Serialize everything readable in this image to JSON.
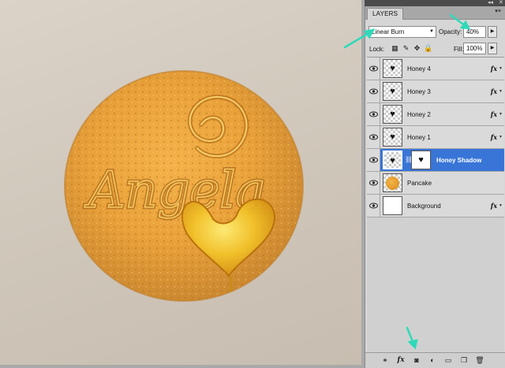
{
  "panel": {
    "tab_label": "LAYERS",
    "menu_icon": "panel-menu-icon",
    "collapse_icon": "collapse-icon",
    "close_icon": "close-icon"
  },
  "blend": {
    "mode": "Linear Burn",
    "opacity_label": "Opacity:",
    "opacity_value": "40%"
  },
  "lock": {
    "label": "Lock:",
    "icons": [
      "lock-transparent-pixels-icon",
      "lock-image-pixels-icon",
      "lock-position-icon",
      "lock-all-icon"
    ],
    "fill_label": "Fill:",
    "fill_value": "100%"
  },
  "layers": [
    {
      "name": "Honey 4",
      "fx": "fx",
      "visible": true,
      "selected": false
    },
    {
      "name": "Honey 3",
      "fx": "fx",
      "visible": true,
      "selected": false
    },
    {
      "name": "Honey 2",
      "fx": "fx",
      "visible": true,
      "selected": false
    },
    {
      "name": "Honey 1",
      "fx": "fx",
      "visible": true,
      "selected": false
    },
    {
      "name": "Honey Shadow",
      "fx": "",
      "visible": true,
      "selected": true
    },
    {
      "name": "Pancake",
      "fx": "",
      "visible": true,
      "selected": false
    },
    {
      "name": "Background",
      "fx": "fx",
      "visible": true,
      "selected": false
    }
  ],
  "canvas": {
    "text": "Angela"
  },
  "colors": {
    "selection": "#3875d7",
    "annotation_arrow": "#2fd9b9",
    "pancake": "#e9a33a"
  }
}
